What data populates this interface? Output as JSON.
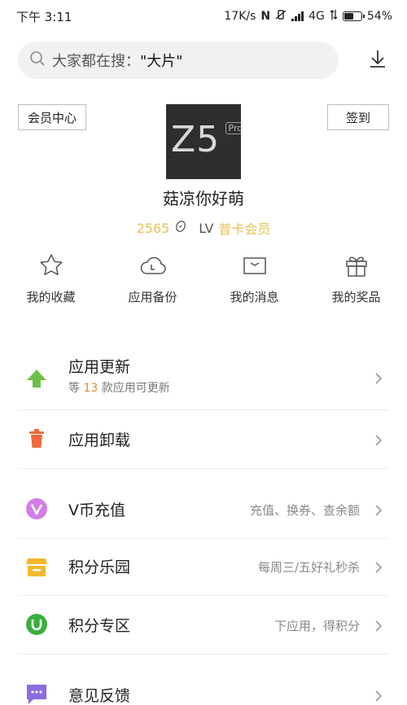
{
  "status_bar": {
    "time": "下午 3:11",
    "speed": "17K/s",
    "network": "4G",
    "battery": "54%",
    "battery_level": 0.54
  },
  "search": {
    "prefix": "大家都在搜：",
    "keyword": "\"大片\""
  },
  "profile": {
    "member_center": "会员中心",
    "sign_in": "签到",
    "avatar_text": "Z5",
    "avatar_badge": "Pro",
    "username": "菇凉你好萌",
    "points": "2565",
    "level_label": "LV",
    "member_type": "普卡会员"
  },
  "quick_actions": [
    {
      "label": "我的收藏",
      "icon": "star-icon"
    },
    {
      "label": "应用备份",
      "icon": "cloud-icon"
    },
    {
      "label": "我的消息",
      "icon": "message-icon"
    },
    {
      "label": "我的奖品",
      "icon": "gift-icon"
    }
  ],
  "menu": {
    "update": {
      "title": "应用更新",
      "sub_prefix": "等",
      "count": "13",
      "sub_suffix": "款应用可更新"
    },
    "uninstall": {
      "title": "应用卸载"
    },
    "vcoin": {
      "title": "V币充值",
      "hint": "充值、换券、查余额"
    },
    "points_park": {
      "title": "积分乐园",
      "hint": "每周三/五好礼秒杀"
    },
    "points_zone": {
      "title": "积分专区",
      "hint": "下应用，得积分"
    },
    "feedback": {
      "title": "意见反馈"
    }
  },
  "colors": {
    "gold": "#e8c251",
    "update_green": "#6cc04a",
    "uninstall_orange": "#ee6a3c",
    "vcoin_purple": "#d27ee6",
    "park_yellow": "#f5b82e",
    "zone_green": "#3aae3e",
    "feedback_purple": "#8a6de0"
  }
}
